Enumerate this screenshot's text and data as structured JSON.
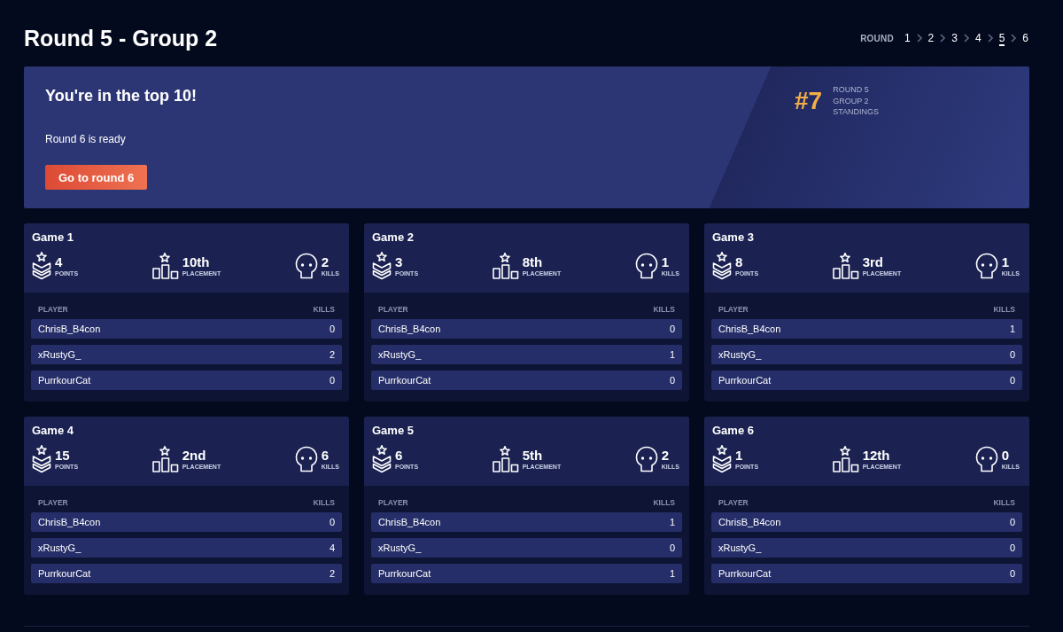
{
  "page": {
    "title": "Round 5 - Group 2"
  },
  "round_nav": {
    "label": "ROUND",
    "rounds": [
      {
        "label": "1",
        "selected": false
      },
      {
        "label": "2",
        "selected": false
      },
      {
        "label": "3",
        "selected": false
      },
      {
        "label": "4",
        "selected": false
      },
      {
        "label": "5",
        "selected": true
      },
      {
        "label": "6",
        "selected": false
      }
    ]
  },
  "banner": {
    "title": "You're in the top 10!",
    "message": "Round 6 is ready",
    "button": "Go to round 6",
    "rank": "#7",
    "rank_caption": [
      "ROUND 5",
      "GROUP 2",
      "STANDINGS"
    ]
  },
  "games": [
    {
      "title": "Game 1",
      "stats": [
        {
          "kind": "points",
          "value": "4",
          "label": "POINTS"
        },
        {
          "kind": "placement",
          "value": "10th",
          "label": "PLACEMENT"
        },
        {
          "kind": "kills",
          "value": "2",
          "label": "KILLS"
        }
      ],
      "table": {
        "columns": [
          "PLAYER",
          "KILLS"
        ],
        "rows": [
          {
            "player": "ChrisB_B4con",
            "kills": "0"
          },
          {
            "player": "xRustyG_",
            "kills": "2"
          },
          {
            "player": "PurrkourCat",
            "kills": "0"
          }
        ]
      }
    },
    {
      "title": "Game 2",
      "stats": [
        {
          "kind": "points",
          "value": "3",
          "label": "POINTS"
        },
        {
          "kind": "placement",
          "value": "8th",
          "label": "PLACEMENT"
        },
        {
          "kind": "kills",
          "value": "1",
          "label": "KILLS"
        }
      ],
      "table": {
        "columns": [
          "PLAYER",
          "KILLS"
        ],
        "rows": [
          {
            "player": "ChrisB_B4con",
            "kills": "0"
          },
          {
            "player": "xRustyG_",
            "kills": "1"
          },
          {
            "player": "PurrkourCat",
            "kills": "0"
          }
        ]
      }
    },
    {
      "title": "Game 3",
      "stats": [
        {
          "kind": "points",
          "value": "8",
          "label": "POINTS"
        },
        {
          "kind": "placement",
          "value": "3rd",
          "label": "PLACEMENT"
        },
        {
          "kind": "kills",
          "value": "1",
          "label": "KILLS"
        }
      ],
      "table": {
        "columns": [
          "PLAYER",
          "KILLS"
        ],
        "rows": [
          {
            "player": "ChrisB_B4con",
            "kills": "1"
          },
          {
            "player": "xRustyG_",
            "kills": "0"
          },
          {
            "player": "PurrkourCat",
            "kills": "0"
          }
        ]
      }
    },
    {
      "title": "Game 4",
      "stats": [
        {
          "kind": "points",
          "value": "15",
          "label": "POINTS"
        },
        {
          "kind": "placement",
          "value": "2nd",
          "label": "PLACEMENT"
        },
        {
          "kind": "kills",
          "value": "6",
          "label": "KILLS"
        }
      ],
      "table": {
        "columns": [
          "PLAYER",
          "KILLS"
        ],
        "rows": [
          {
            "player": "ChrisB_B4con",
            "kills": "0"
          },
          {
            "player": "xRustyG_",
            "kills": "4"
          },
          {
            "player": "PurrkourCat",
            "kills": "2"
          }
        ]
      }
    },
    {
      "title": "Game 5",
      "stats": [
        {
          "kind": "points",
          "value": "6",
          "label": "POINTS"
        },
        {
          "kind": "placement",
          "value": "5th",
          "label": "PLACEMENT"
        },
        {
          "kind": "kills",
          "value": "2",
          "label": "KILLS"
        }
      ],
      "table": {
        "columns": [
          "PLAYER",
          "KILLS"
        ],
        "rows": [
          {
            "player": "ChrisB_B4con",
            "kills": "1"
          },
          {
            "player": "xRustyG_",
            "kills": "0"
          },
          {
            "player": "PurrkourCat",
            "kills": "1"
          }
        ]
      }
    },
    {
      "title": "Game 6",
      "stats": [
        {
          "kind": "points",
          "value": "1",
          "label": "POINTS"
        },
        {
          "kind": "placement",
          "value": "12th",
          "label": "PLACEMENT"
        },
        {
          "kind": "kills",
          "value": "0",
          "label": "KILLS"
        }
      ],
      "table": {
        "columns": [
          "PLAYER",
          "KILLS"
        ],
        "rows": [
          {
            "player": "ChrisB_B4con",
            "kills": "0"
          },
          {
            "player": "xRustyG_",
            "kills": "0"
          },
          {
            "player": "PurrkourCat",
            "kills": "0"
          }
        ]
      }
    }
  ]
}
